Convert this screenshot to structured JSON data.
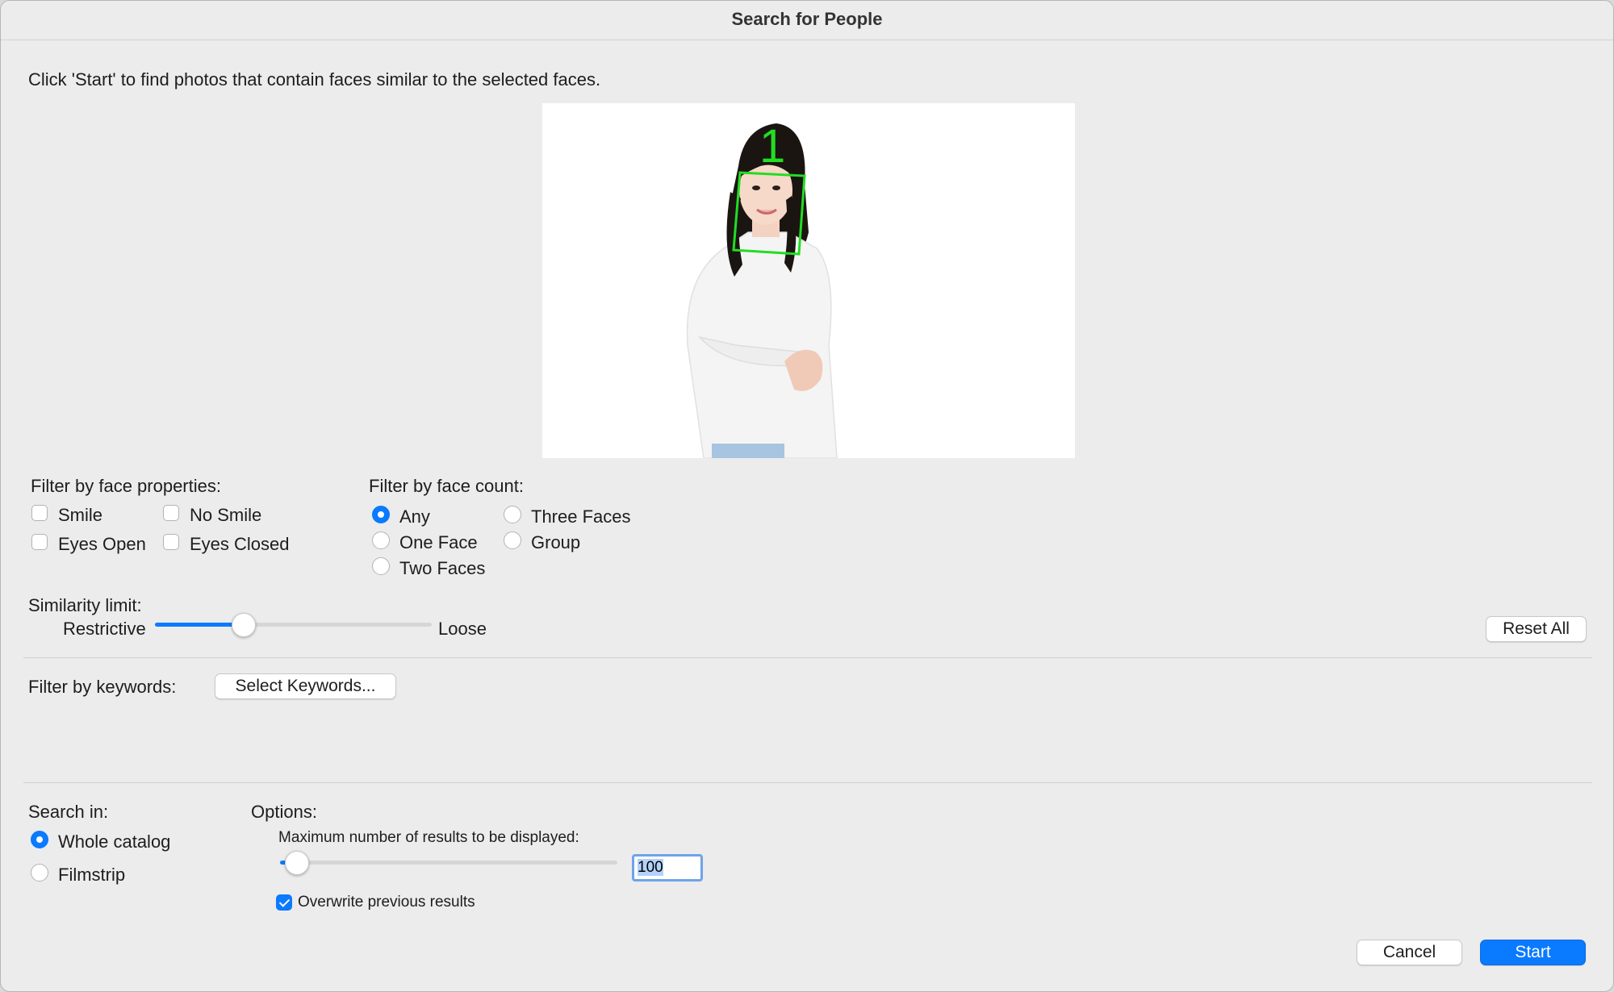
{
  "window": {
    "title": "Search for People"
  },
  "instructions": "Click 'Start' to find photos that contain faces similar to the selected faces.",
  "preview": {
    "face_label": "1"
  },
  "face_properties": {
    "label": "Filter by face properties:",
    "options": [
      {
        "label": "Smile",
        "checked": false
      },
      {
        "label": "No Smile",
        "checked": false
      },
      {
        "label": "Eyes Open",
        "checked": false
      },
      {
        "label": "Eyes Closed",
        "checked": false
      }
    ]
  },
  "face_count": {
    "label": "Filter by face count:",
    "options": [
      {
        "label": "Any",
        "selected": true
      },
      {
        "label": "One Face",
        "selected": false
      },
      {
        "label": "Two Faces",
        "selected": false
      },
      {
        "label": "Three Faces",
        "selected": false
      },
      {
        "label": "Group",
        "selected": false
      }
    ]
  },
  "similarity": {
    "label": "Similarity limit:",
    "min_label": "Restrictive",
    "max_label": "Loose",
    "value_fraction": 0.32
  },
  "reset_label": "Reset All",
  "keywords": {
    "label": "Filter by keywords:",
    "button_label": "Select Keywords..."
  },
  "search_in": {
    "label": "Search in:",
    "options": [
      {
        "label": "Whole catalog",
        "selected": true
      },
      {
        "label": "Filmstrip",
        "selected": false
      }
    ]
  },
  "options": {
    "label": "Options:",
    "max_results_label": "Maximum number of results to be displayed:",
    "max_results_value": "100",
    "max_results_fraction": 0.05,
    "overwrite_label": "Overwrite previous results",
    "overwrite_checked": true
  },
  "buttons": {
    "cancel": "Cancel",
    "start": "Start"
  },
  "colors": {
    "accent": "#0a7aff",
    "face_box": "#22dd22"
  }
}
